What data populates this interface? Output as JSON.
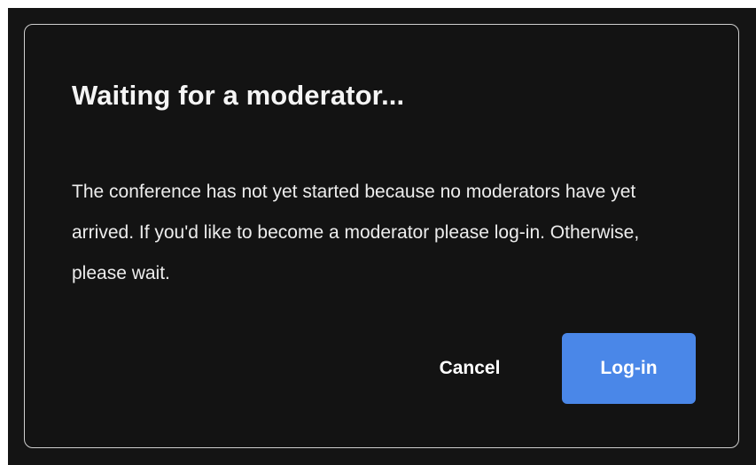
{
  "dialog": {
    "title": "Waiting for a moderator...",
    "message": "The conference has not yet started because no moderators have yet arrived. If you'd like to become a moderator please log-in. Otherwise, please wait.",
    "cancel_label": "Cancel",
    "login_label": "Log-in"
  },
  "colors": {
    "background": "#141414",
    "dialog_border": "#cfcfcf",
    "primary_button": "#4a87e8",
    "text": "#ffffff"
  }
}
